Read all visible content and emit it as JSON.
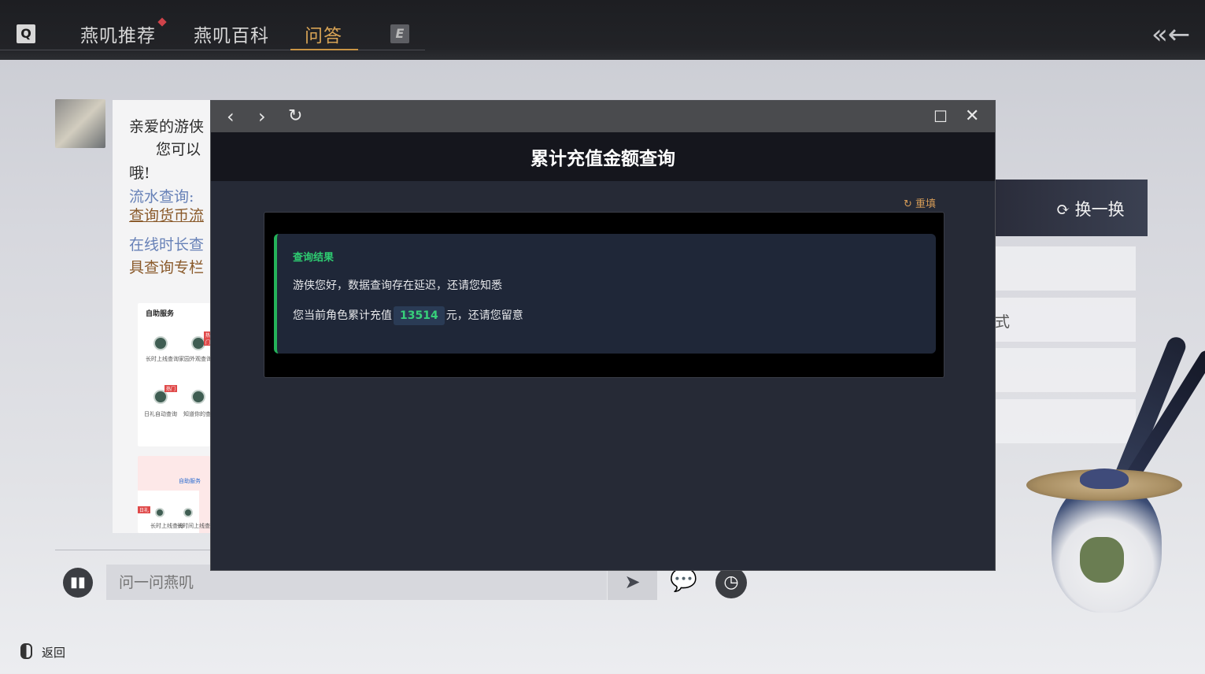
{
  "topbar": {
    "q_key": "Q",
    "e_key": "E",
    "tabs": [
      {
        "label": "燕叽推荐"
      },
      {
        "label": "燕叽百科"
      },
      {
        "label": "问答"
      }
    ],
    "back_icon": "double-chevron-left-icon",
    "active_color": "#d7a355"
  },
  "chat": {
    "lines": [
      "亲爱的游侠",
      "您可以",
      "哦!",
      "流水查询:",
      "查询货币流",
      "在线时长查",
      "具查询专栏"
    ],
    "card": {
      "title": "自助服务",
      "items": [
        "长时上线查询",
        "家园外观查询",
        "日礼自动查询",
        "知道你的查询"
      ],
      "badges": [
        "热门",
        "热门"
      ],
      "bottom_title": "自助服务",
      "bottom_items": [
        "日礼",
        "长时上线查询",
        "长时间上线查询"
      ]
    }
  },
  "right_panel": {
    "refresh_label": "换一换",
    "rows": [
      "",
      "",
      "",
      ""
    ],
    "row_chars": [
      "式"
    ]
  },
  "input_bar": {
    "placeholder": "问一问燕叽",
    "return_label": "返回"
  },
  "modal": {
    "title": "累计充值金额查询",
    "reset_label": "重填",
    "result_label": "查询结果",
    "line1": "游侠您好，数据查询存在延迟，还请您知悉",
    "line2_prefix": "您当前角色累计充值",
    "amount": "13514",
    "line2_suffix": "元，还请您留意",
    "accent_color": "#25b35a"
  }
}
